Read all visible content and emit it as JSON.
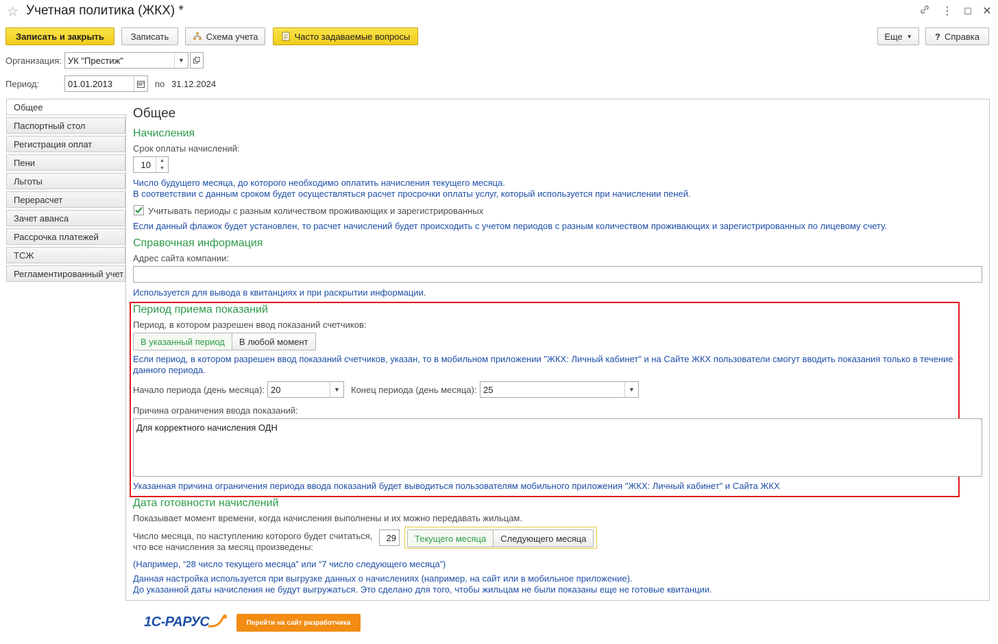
{
  "window": {
    "title": "Учетная политика (ЖКХ) *"
  },
  "toolbar": {
    "save_close": "Записать и закрыть",
    "save": "Записать",
    "scheme": "Схема учета",
    "faq": "Часто задаваемые вопросы",
    "more": "Еще",
    "help_q": "?",
    "help": "Справка"
  },
  "header": {
    "org_label": "Организация:",
    "org_value": "УК \"Престиж\"",
    "period_label": "Период:",
    "period_from": "01.01.2013",
    "period_to_label": "по",
    "period_to": "31.12.2024"
  },
  "tabs": [
    {
      "label": "Общее"
    },
    {
      "label": "Паспортный стол"
    },
    {
      "label": "Регистрация оплат"
    },
    {
      "label": "Пени"
    },
    {
      "label": "Льготы"
    },
    {
      "label": "Перерасчет"
    },
    {
      "label": "Зачет аванса"
    },
    {
      "label": "Рассрочка платежей"
    },
    {
      "label": "ТСЖ"
    },
    {
      "label": "Регламентированный учет"
    }
  ],
  "main": {
    "title": "Общее",
    "accruals": {
      "heading": "Начисления",
      "due_label": "Срок оплаты начислений:",
      "due_value": "10",
      "note1": "Число будущего месяца, до которого необходимо оплатить начисления текущего месяца.",
      "note2": "В соответствии с данным сроком будет осуществляться расчет просрочки оплаты услуг, который используется при начислении пеней.",
      "checkbox_label": "Учитывать периоды с разным количеством проживающих и зарегистрированных",
      "checkbox_checked": true,
      "checkbox_note": "Если данный флажок будет установлен, то расчет начислений будет происходить с учетом периодов с разным количеством проживающих и зарегистрированных по лицевому счету."
    },
    "reference": {
      "heading": "Справочная информация",
      "site_label": "Адрес сайта компании:",
      "site_value": "",
      "note": "Используется для вывода в квитанциях и при раскрытии информации."
    },
    "readings": {
      "heading": "Период приема показаний",
      "period_label": "Период, в котором разрешен ввод показаний счетчиков:",
      "option_period": "В указанный период",
      "option_any": "В любой момент",
      "note_line1": "Если период, в котором разрешен ввод показаний счетчиков, указан, то в мобильном приложении \"ЖКХ: Личный кабинет\" и на Сайте ЖКХ пользователи смогут вводить показания только в течение",
      "note_line2": "данного периода.",
      "start_label": "Начало периода (день месяца):",
      "start_value": "20",
      "end_label": "Конец периода (день месяца):",
      "end_value": "25",
      "reason_label": "Причина ограничения ввода показаний:",
      "reason_value": "Для корректного начисления ОДН",
      "reason_note": "Указанная причина ограничения периода ввода показаний будет выводиться пользователям мобильного приложения \"ЖКХ: Личный кабинет\" и Сайта ЖКХ"
    },
    "ready": {
      "heading": "Дата готовности начислений",
      "desc": "Показывает момент времени, когда начисления выполнены и их можно передавать жильцам.",
      "day_label1": "Число месяца, по наступлению которого будет считаться,",
      "day_label2": "что все начисления за месяц произведены:",
      "day_value": "29",
      "option_current": "Текущего месяца",
      "option_next": "Следующего месяца",
      "example": "(Например, “28 число текущего месяца” или “7 число следующего месяца”)",
      "note1": "Данная настройка используется при выгрузке данных о начислениях (например, на сайт или в мобильное приложение).",
      "note2": "До указанной даты начисления не будут выгружаться. Это сделано для того, чтобы жильцам не были показаны еще не готовые квитанции."
    }
  },
  "footer": {
    "logo_text": "1С-РАРУС",
    "dev_site_button": "Перейти на сайт разработчика"
  },
  "colors": {
    "accent_green": "#2e9b4a",
    "note_blue": "#1f4ea8",
    "primary_yellow": "#f0cc1c",
    "highlight_red": "#e0161c",
    "footer_orange": "#f28c12"
  }
}
